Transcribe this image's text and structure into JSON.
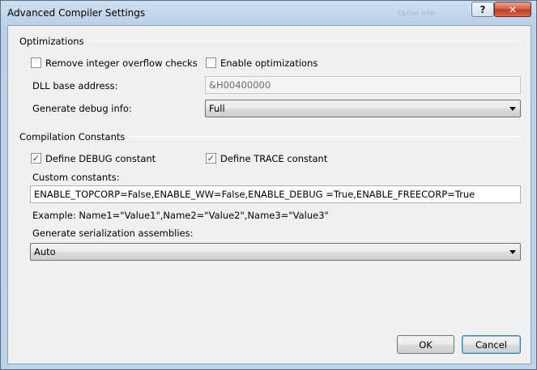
{
  "window": {
    "title": "Advanced Compiler Settings",
    "background_ghost_text": "Option infer",
    "help_glyph": "?",
    "close_glyph": "✕"
  },
  "optimizations": {
    "group_title": "Optimizations",
    "remove_overflow": {
      "label": "Remove integer overflow checks",
      "checked": false
    },
    "enable_optimizations": {
      "label": "Enable optimizations",
      "checked": false
    },
    "dll_base_label": "DLL base address:",
    "dll_base_value": "&H00400000",
    "debug_info_label": "Generate debug info:",
    "debug_info_value": "Full"
  },
  "constants": {
    "group_title": "Compilation Constants",
    "define_debug": {
      "label": "Define DEBUG constant",
      "checked": true
    },
    "define_trace": {
      "label": "Define TRACE constant",
      "checked": true
    },
    "custom_label": "Custom constants:",
    "custom_value": "ENABLE_TOPCORP=False,ENABLE_WW=False,ENABLE_DEBUG =True,ENABLE_FREECORP=True",
    "example_text": "Example: Name1=\"Value1\",Name2=\"Value2\",Name3=\"Value3\"",
    "serialization_label": "Generate serialization assemblies:",
    "serialization_value": "Auto"
  },
  "buttons": {
    "ok": "OK",
    "cancel": "Cancel"
  },
  "checkmark_glyph": "✓"
}
